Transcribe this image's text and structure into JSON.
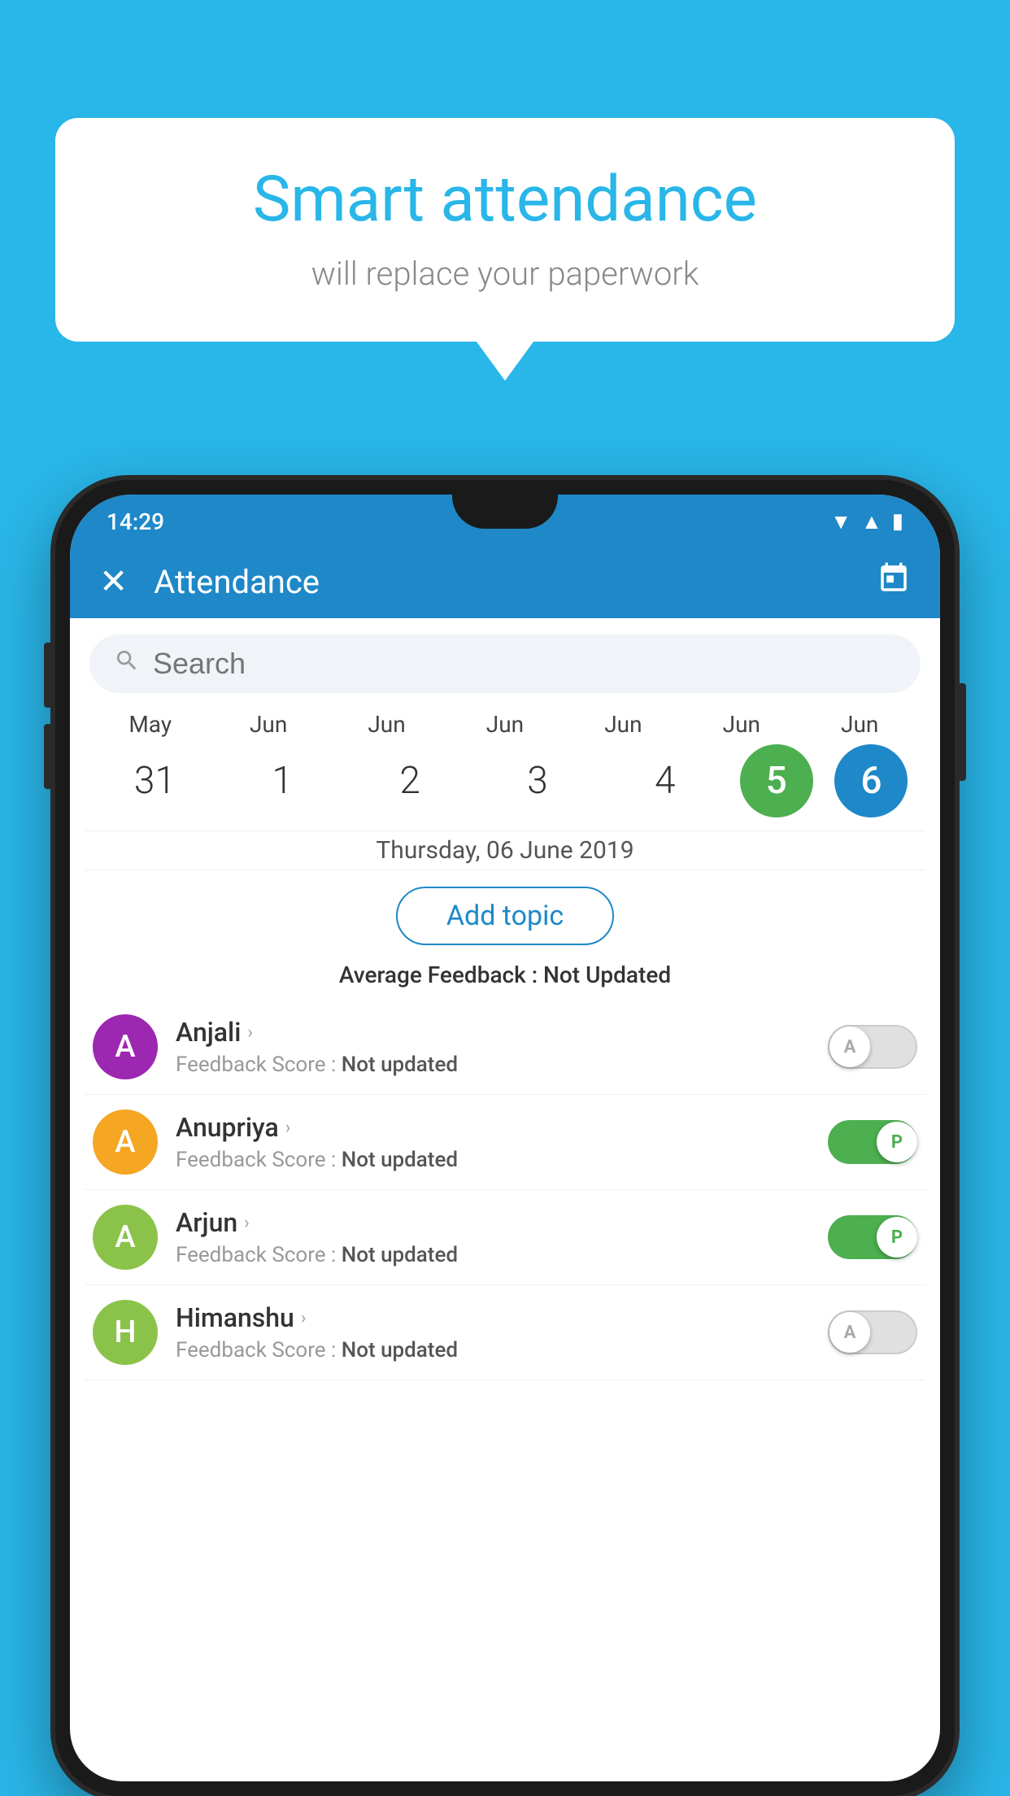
{
  "background_color": "#29b6e8",
  "speech_bubble": {
    "title": "Smart attendance",
    "subtitle": "will replace your paperwork"
  },
  "status_bar": {
    "time": "14:29",
    "wifi": "▼",
    "signal": "▲",
    "battery": "▮"
  },
  "app_bar": {
    "close_label": "✕",
    "title": "Attendance",
    "calendar_icon": "📅"
  },
  "search": {
    "placeholder": "Search"
  },
  "dates": [
    {
      "month": "May",
      "day": "31",
      "state": "normal"
    },
    {
      "month": "Jun",
      "day": "1",
      "state": "normal"
    },
    {
      "month": "Jun",
      "day": "2",
      "state": "normal"
    },
    {
      "month": "Jun",
      "day": "3",
      "state": "normal"
    },
    {
      "month": "Jun",
      "day": "4",
      "state": "normal"
    },
    {
      "month": "Jun",
      "day": "5",
      "state": "today"
    },
    {
      "month": "Jun",
      "day": "6",
      "state": "selected"
    }
  ],
  "selected_date_label": "Thursday, 06 June 2019",
  "add_topic_label": "Add topic",
  "avg_feedback_label": "Average Feedback :",
  "avg_feedback_value": "Not Updated",
  "students": [
    {
      "name": "Anjali",
      "avatar_letter": "A",
      "avatar_color": "#9c27b0",
      "feedback_label": "Feedback Score :",
      "feedback_value": "Not updated",
      "toggle_state": "off",
      "toggle_label": "A"
    },
    {
      "name": "Anupriya",
      "avatar_letter": "A",
      "avatar_color": "#f5a623",
      "feedback_label": "Feedback Score :",
      "feedback_value": "Not updated",
      "toggle_state": "on",
      "toggle_label": "P"
    },
    {
      "name": "Arjun",
      "avatar_letter": "A",
      "avatar_color": "#8bc34a",
      "feedback_label": "Feedback Score :",
      "feedback_value": "Not updated",
      "toggle_state": "on",
      "toggle_label": "P"
    },
    {
      "name": "Himanshu",
      "avatar_letter": "H",
      "avatar_color": "#8bc34a",
      "feedback_label": "Feedback Score :",
      "feedback_value": "Not updated",
      "toggle_state": "off",
      "toggle_label": "A"
    }
  ]
}
